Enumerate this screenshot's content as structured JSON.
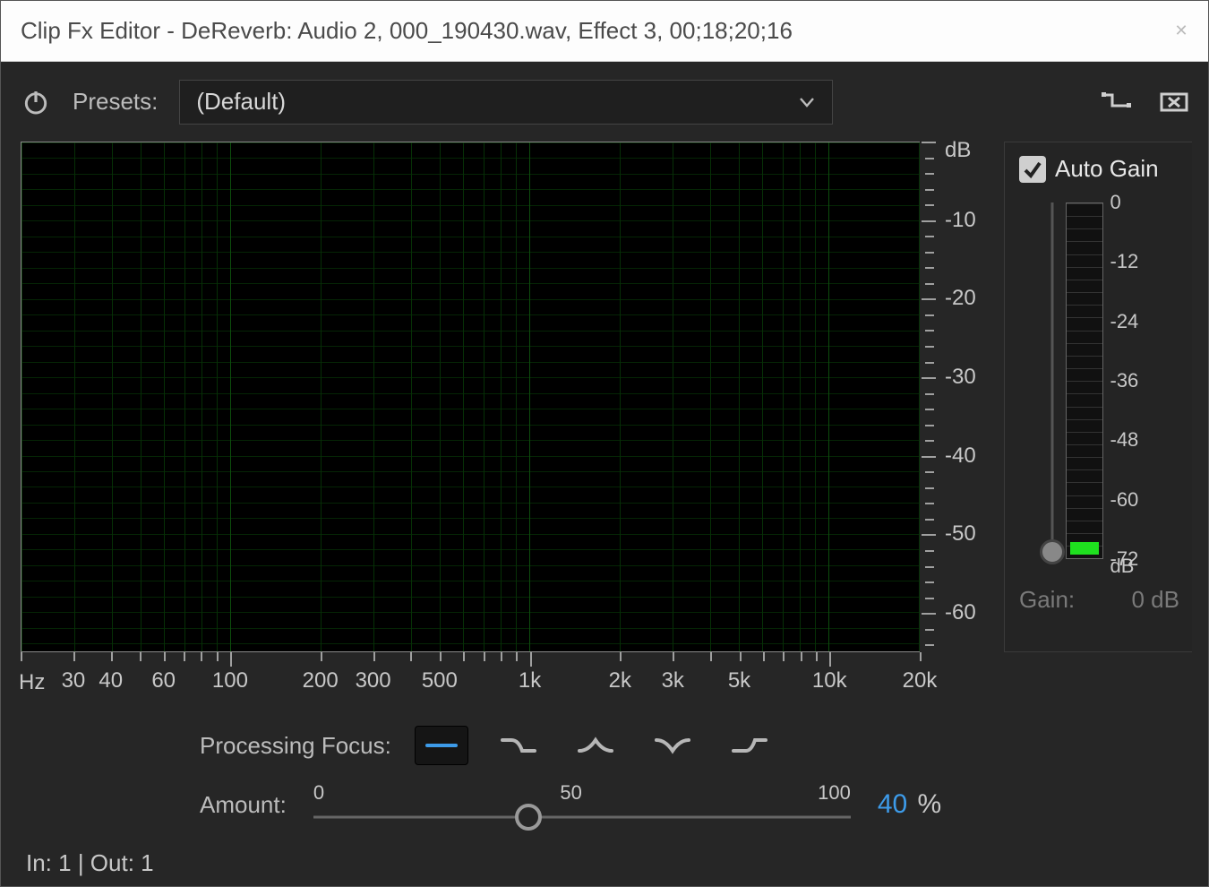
{
  "title": "Clip Fx Editor - DeReverb: Audio 2, 000_190430.wav, Effect 3, 00;18;20;16",
  "toolbar": {
    "presets_label": "Presets:",
    "preset_value": "(Default)"
  },
  "chart_data": {
    "type": "line",
    "title": "",
    "xlabel": "Hz",
    "ylabel": "dB",
    "x_scale": "log",
    "xlim": [
      20,
      20000
    ],
    "ylim": [
      -65,
      0
    ],
    "x_ticks_major": [
      100,
      1000,
      10000
    ],
    "x_ticks_labeled": [
      {
        "v": 30,
        "l": "30"
      },
      {
        "v": 40,
        "l": "40"
      },
      {
        "v": 60,
        "l": "60"
      },
      {
        "v": 100,
        "l": "100"
      },
      {
        "v": 200,
        "l": "200"
      },
      {
        "v": 300,
        "l": "300"
      },
      {
        "v": 500,
        "l": "500"
      },
      {
        "v": 1000,
        "l": "1k"
      },
      {
        "v": 2000,
        "l": "2k"
      },
      {
        "v": 3000,
        "l": "3k"
      },
      {
        "v": 5000,
        "l": "5k"
      },
      {
        "v": 10000,
        "l": "10k"
      },
      {
        "v": 20000,
        "l": "20k"
      }
    ],
    "y_ticks": [
      0,
      -10,
      -20,
      -30,
      -40,
      -50,
      -60
    ],
    "series": []
  },
  "sidebar": {
    "auto_gain_label": "Auto Gain",
    "auto_gain_checked": true,
    "meter_unit": "dB",
    "meter_ticks": [
      0,
      -12,
      -24,
      -36,
      -48,
      -60,
      -72
    ],
    "meter_range": [
      -72,
      0
    ],
    "gain_label": "Gain:",
    "gain_value": "0 dB"
  },
  "focus": {
    "label": "Processing Focus:",
    "options": [
      "all",
      "low-shelf",
      "peak",
      "notch",
      "high-shelf"
    ],
    "selected": "all"
  },
  "amount": {
    "label": "Amount:",
    "min": 0,
    "mid": 50,
    "max": 100,
    "value": 40,
    "unit": "%"
  },
  "io": {
    "text": "In: 1 | Out: 1"
  }
}
